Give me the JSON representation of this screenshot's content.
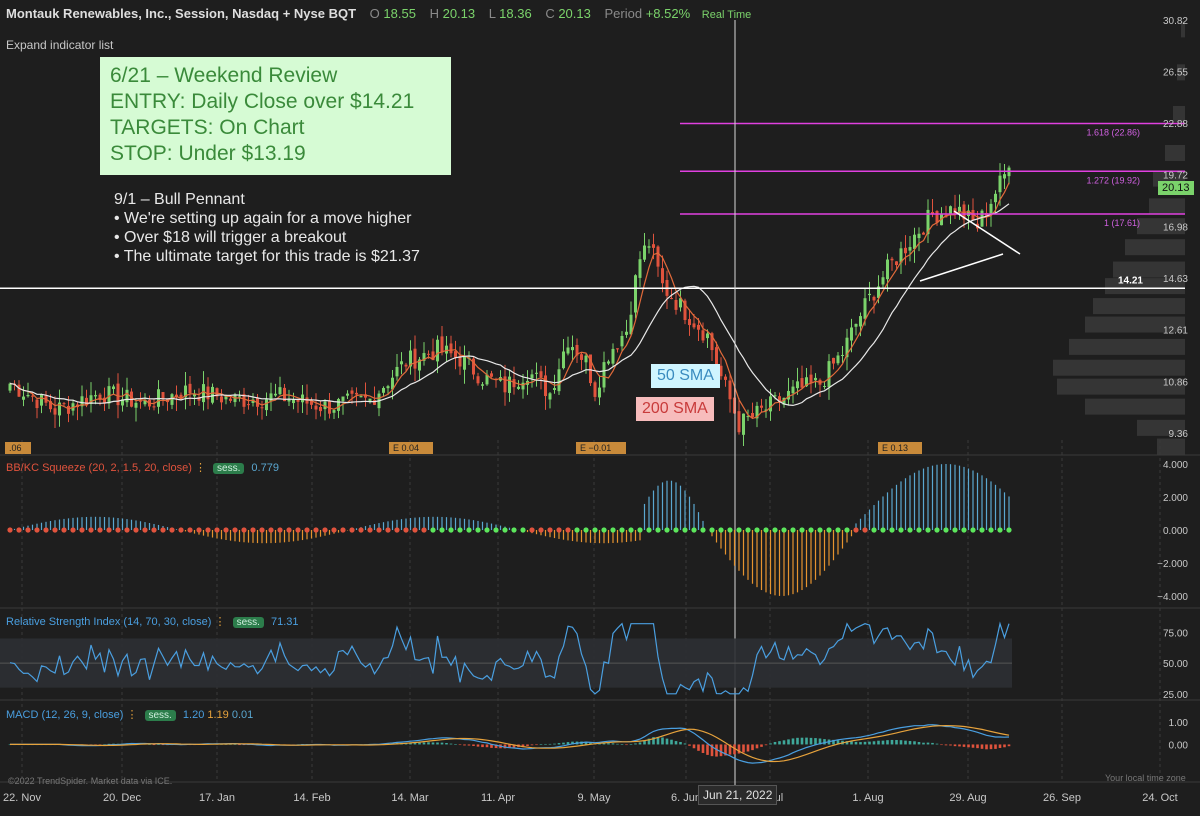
{
  "header": {
    "title": "Montauk Renewables, Inc., Session, Nasdaq + Nyse BQT",
    "o_label": "O",
    "o_value": "18.55",
    "h_label": "H",
    "h_value": "20.13",
    "l_label": "L",
    "l_value": "18.36",
    "c_label": "C",
    "c_value": "20.13",
    "period_label": "Period",
    "period_value": "+8.52%",
    "realtime": "Real Time"
  },
  "expand_label": "Expand indicator list",
  "note_box": [
    "6/21 – Weekend Review",
    "ENTRY: Daily Close over $14.21",
    "TARGETS: On Chart",
    "STOP: Under $13.19"
  ],
  "note_text": [
    "9/1 – Bull Pennant",
    "• We're setting up again for a move higher",
    "• Over $18 will trigger a breakout",
    "• The ultimate target for this trade is $21.37"
  ],
  "sma_labels": {
    "sma50": "50 SMA",
    "sma200": "200 SMA"
  },
  "last_price": "20.13",
  "cursor_date": "Jun 21, 2022",
  "copyright": "©2022 TrendSpider. Market data via ICE.",
  "local_time": "Your local time zone",
  "colors": {
    "up": "#7bd36b",
    "down": "#e0533d",
    "bg": "#1e1e1e",
    "fib": "#e040e0",
    "sma_fast": "#e26a3a",
    "sma_slow": "#e8e8e8",
    "hist_pos": "#5aa7d0",
    "hist_neg": "#e6932f",
    "rsi": "#4a9fe0",
    "macd": "#4a9fe0",
    "signal": "#e6a23c"
  },
  "indicators": {
    "squeeze": {
      "label": "BB/KC Squeeze (20, 2, 1.5, 20, close)",
      "sess": "sess.",
      "value": "0.779"
    },
    "rsi": {
      "label": "Relative Strength Index (14, 70, 30, close)",
      "sess": "sess.",
      "value": "71.31"
    },
    "macd": {
      "label": "MACD (12, 26, 9, close)",
      "sess": "sess.",
      "v1": "1.20",
      "v2": "1.19",
      "v3": "0.01"
    }
  },
  "chart_data": {
    "type": "candlestick",
    "price_axis": {
      "ticks": [
        30.82,
        26.55,
        22.88,
        19.72,
        16.98,
        14.63,
        12.61,
        10.86,
        9.36
      ],
      "scale": "log"
    },
    "x_ticks": [
      "22. Nov",
      "20. Dec",
      "17. Jan",
      "14. Feb",
      "14. Mar",
      "11. Apr",
      "9. May",
      "6. Jun",
      "4. Jul",
      "1. Aug",
      "29. Aug",
      "26. Sep",
      "24. Oct"
    ],
    "horizontal_levels": [
      {
        "value": 14.21,
        "label": "14.21",
        "color": "#ffffff"
      },
      {
        "value": 22.86,
        "label": "1.618 (22.86)",
        "color": "#e040e0"
      },
      {
        "value": 19.92,
        "label": "1.272 (19.92)",
        "color": "#e040e0"
      },
      {
        "value": 17.61,
        "label": "1 (17.61)",
        "color": "#e040e0"
      }
    ],
    "earnings_markers": [
      ".06",
      "E 0.04",
      "E −0.01",
      "E 0.13"
    ],
    "squeeze_axis": {
      "ticks": [
        "4.000",
        "2.000",
        "0.000",
        "−2.000",
        "−4.000"
      ],
      "range": [
        -4,
        4
      ]
    },
    "rsi_axis": {
      "ticks": [
        "75.00",
        "50.00",
        "25.00"
      ],
      "range": [
        20,
        85
      ],
      "bands": [
        30,
        70
      ]
    },
    "macd_axis": {
      "ticks": [
        "1.00",
        "0.00"
      ],
      "range": [
        -1.6,
        2.0
      ]
    },
    "close_keyframes": [
      [
        0,
        10.8
      ],
      [
        10,
        10.0
      ],
      [
        20,
        10.5
      ],
      [
        30,
        10.2
      ],
      [
        40,
        10.6
      ],
      [
        50,
        10.3
      ],
      [
        60,
        10.4
      ],
      [
        70,
        10.1
      ],
      [
        80,
        10.3
      ],
      [
        88,
        11.5
      ],
      [
        95,
        11.9
      ],
      [
        100,
        11.6
      ],
      [
        105,
        11.0
      ],
      [
        110,
        10.7
      ],
      [
        115,
        11.2
      ],
      [
        120,
        10.5
      ],
      [
        124,
        12.3
      ],
      [
        128,
        11.5
      ],
      [
        130,
        10.6
      ],
      [
        133,
        11.8
      ],
      [
        137,
        12.6
      ],
      [
        140,
        15.5
      ],
      [
        142,
        16.2
      ],
      [
        145,
        14.3
      ],
      [
        150,
        13.3
      ],
      [
        155,
        12.4
      ],
      [
        158,
        11.0
      ],
      [
        162,
        9.6
      ],
      [
        165,
        9.8
      ],
      [
        170,
        10.2
      ],
      [
        175,
        10.6
      ],
      [
        180,
        10.8
      ],
      [
        185,
        11.8
      ],
      [
        190,
        13.5
      ],
      [
        195,
        15.0
      ],
      [
        200,
        16.3
      ],
      [
        205,
        17.6
      ],
      [
        210,
        17.9
      ],
      [
        215,
        17.0
      ],
      [
        218,
        18.3
      ],
      [
        222,
        20.13
      ]
    ],
    "volume_profile": [
      {
        "price": 30.0,
        "width": 0.1
      },
      {
        "price": 26.5,
        "width": 0.2
      },
      {
        "price": 23.5,
        "width": 0.3
      },
      {
        "price": 21.0,
        "width": 0.5
      },
      {
        "price": 19.5,
        "width": 0.8
      },
      {
        "price": 18.0,
        "width": 0.9
      },
      {
        "price": 17.0,
        "width": 1.2
      },
      {
        "price": 16.0,
        "width": 1.5
      },
      {
        "price": 15.0,
        "width": 1.8
      },
      {
        "price": 14.3,
        "width": 2.0
      },
      {
        "price": 13.5,
        "width": 2.3
      },
      {
        "price": 12.8,
        "width": 2.5
      },
      {
        "price": 12.0,
        "width": 2.9
      },
      {
        "price": 11.3,
        "width": 3.3
      },
      {
        "price": 10.7,
        "width": 3.2
      },
      {
        "price": 10.1,
        "width": 2.5
      },
      {
        "price": 9.5,
        "width": 1.2
      },
      {
        "price": 9.0,
        "width": 0.7
      }
    ]
  }
}
